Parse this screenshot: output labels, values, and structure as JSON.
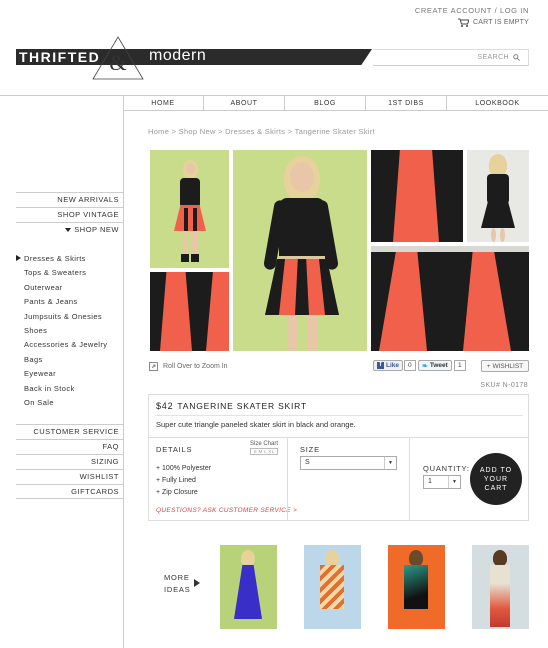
{
  "header": {
    "create_account": "CREATE ACCOUNT",
    "separator": "/",
    "login": "LOG IN",
    "cart": "CART IS EMPTY",
    "logo_left": "THRIFTED",
    "logo_amp": "&",
    "logo_right": "modern",
    "search_placeholder": "SEARCH"
  },
  "nav": [
    "HOME",
    "ABOUT",
    "BLOG",
    "1ST DIBS",
    "LOOKBOOK"
  ],
  "sidebar": {
    "top": [
      "NEW ARRIVALS",
      "SHOP VINTAGE",
      "SHOP NEW"
    ],
    "categories": [
      "Dresses & Skirts",
      "Tops & Sweaters",
      "Outerwear",
      "Pants & Jeans",
      "Jumpsuits & Onesies",
      "Shoes",
      "Accessories & Jewelry",
      "Bags",
      "Eyewear",
      "Back in Stock",
      "On Sale"
    ],
    "active_category": 0,
    "service": [
      "CUSTOMER SERVICE",
      "FAQ",
      "SIZING",
      "WISHLIST",
      "GIFTCARDS"
    ]
  },
  "breadcrumb": "Home > Shop New > Dresses & Skirts > Tangerine Skater Skirt",
  "zoom_text": "Roll Over to Zoom In",
  "social": {
    "like": "Like",
    "like_count": "0",
    "tweet": "Tweet",
    "tweet_count": "1",
    "wishlist": "+ WISHLIST"
  },
  "product": {
    "sku": "SKU# N-0178",
    "price": "$42",
    "name": "TANGERINE SKATER SKIRT",
    "description": "Super cute triangle paneled skater skirt in black and orange.",
    "details_heading": "DETAILS",
    "size_chart": "Size Chart",
    "details": [
      "+ 100% Polyester",
      "+ Fully Lined",
      "+ Zip Closure"
    ],
    "question": "QUESTIONS? ASK CUSTOMER SERVICE >",
    "size_heading": "SIZE",
    "size_value": "S",
    "qty_heading": "QUANTITY:",
    "qty_value": "1",
    "add_to_cart": [
      "ADD TO",
      "YOUR",
      "CART"
    ]
  },
  "more_ideas": [
    "MORE",
    "IDEAS"
  ],
  "colors": {
    "accent_orange": "#f0604a",
    "dark": "#1c1c1c",
    "bg_green": "#c8dc8c",
    "question_red": "#dd4444"
  }
}
